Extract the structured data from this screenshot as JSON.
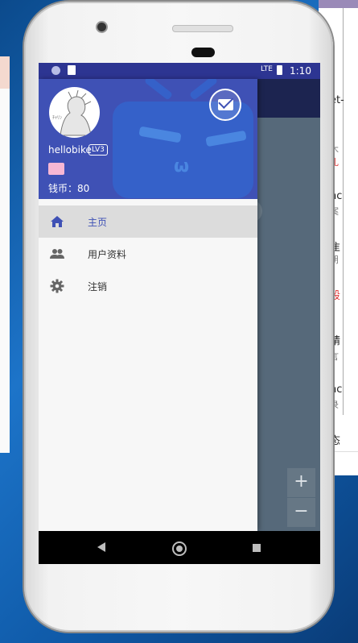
{
  "statusbar": {
    "time": "1:10",
    "network": "LTE"
  },
  "drawer": {
    "username": "hellobike",
    "level": "LV3",
    "coins": "钱币：80",
    "menu": [
      {
        "label": "主页",
        "icon": "home-icon",
        "active": true
      },
      {
        "label": "用户资料",
        "icon": "people-icon",
        "active": false
      },
      {
        "label": "注销",
        "icon": "gear-icon",
        "active": false
      }
    ]
  },
  "map_controls": {
    "zoom_in": "+",
    "zoom_out": "−"
  },
  "background_window": {
    "lines": [
      "et-",
      "木",
      "礼",
      "nc",
      "案",
      "隹",
      "朋",
      "段",
      "y",
      "精",
      "言",
      "nc",
      "录",
      "态"
    ]
  },
  "colors": {
    "accent": "#3f51b5",
    "statusbar": "#2d3592",
    "drawer_bg": "#f7f7f7"
  }
}
